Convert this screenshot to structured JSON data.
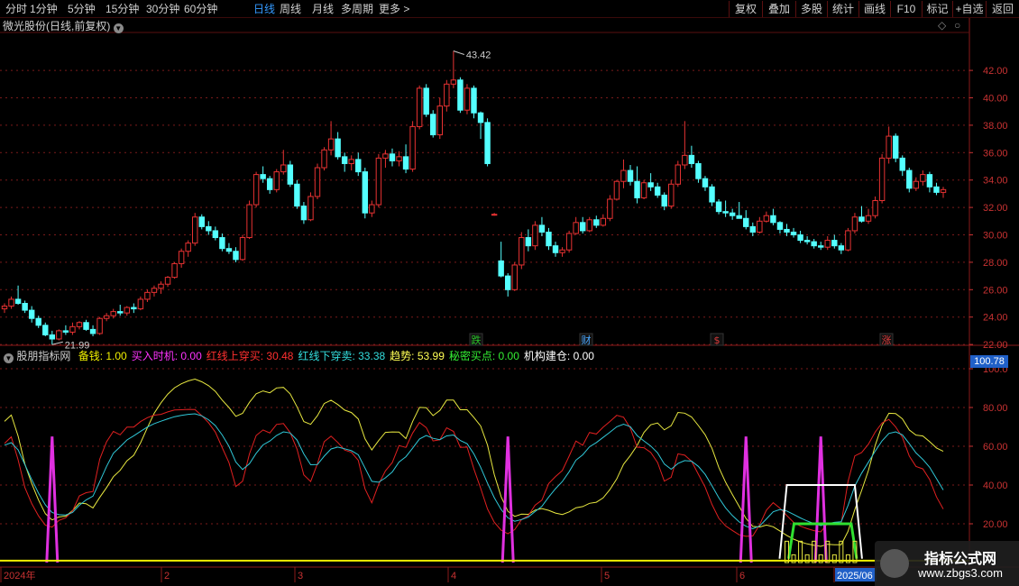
{
  "toolbar": {
    "periods": [
      "分时",
      "1分钟",
      "5分钟",
      "15分钟",
      "30分钟",
      "60分钟",
      "日线",
      "周线",
      "月线",
      "多周期",
      "更多 >"
    ],
    "active_period": "日线",
    "buttons": [
      "复权",
      "叠加",
      "多股",
      "统计",
      "画线",
      "F10",
      "标记",
      "+自选",
      "返回"
    ]
  },
  "main_panel": {
    "title": "微光股份(日线,前复权)",
    "max_label": "43.42",
    "min_label": "21.99",
    "price_axis": [
      "42.00",
      "40.00",
      "38.00",
      "36.00",
      "34.00",
      "32.00",
      "30.00",
      "28.00",
      "26.00",
      "24.00",
      "22.00"
    ],
    "event_marks": [
      {
        "label": "跌",
        "color": "#29c229"
      },
      {
        "label": "财",
        "color": "#4aa8ff"
      },
      {
        "label": "$",
        "color": "#d83a3a"
      },
      {
        "label": "涨",
        "color": "#d83a3a"
      }
    ]
  },
  "indicator_panel": {
    "name": "股朋指标网",
    "items": [
      {
        "label": "备钱:",
        "value": "1.00",
        "color": "#f0f000"
      },
      {
        "label": "买入时机:",
        "value": "0.00",
        "color": "#ff33ff"
      },
      {
        "label": "红线上穿买:",
        "value": "30.48",
        "color": "#ff3030"
      },
      {
        "label": "红线下穿卖:",
        "value": "33.38",
        "color": "#33dddd"
      },
      {
        "label": "趋势:",
        "value": "53.99",
        "color": "#ffff55"
      },
      {
        "label": "秘密买点:",
        "value": "0.00",
        "color": "#33ee33"
      },
      {
        "label": "机构建仓:",
        "value": "0.00",
        "color": "#ffffff"
      }
    ],
    "current_value": "100.78",
    "axis": [
      "100.0",
      "80.00",
      "60.00",
      "40.00",
      "20.00"
    ]
  },
  "date_axis": [
    "2024年",
    "2",
    "3",
    "4",
    "5",
    "6",
    "2025/06"
  ],
  "watermark": {
    "line1": "指标公式网",
    "line2": "www.zbgs3.com"
  },
  "colors": {
    "up": "#e83232",
    "down": "#54ffff",
    "grid": "#7a1a1a",
    "axis_text": "#c83232",
    "red_line": "#e02020",
    "cyan_line": "#30c8d8",
    "yellow_line": "#e8e840",
    "spike": "#e030e0",
    "green_box": "#30e030",
    "white_box": "#ffffff"
  },
  "chart_data": {
    "type": "candlestick",
    "series_note": "daily OHLC, start 2024-01",
    "ylim": [
      21.0,
      43.5
    ],
    "candles": [
      [
        24.6,
        25.0,
        24.3,
        24.8
      ],
      [
        24.8,
        25.5,
        24.6,
        25.3
      ],
      [
        25.3,
        26.3,
        24.9,
        25.0
      ],
      [
        25.0,
        25.2,
        24.3,
        24.5
      ],
      [
        24.5,
        24.8,
        23.6,
        23.9
      ],
      [
        23.9,
        24.1,
        23.2,
        23.4
      ],
      [
        23.4,
        23.6,
        22.6,
        22.7
      ],
      [
        22.7,
        23.0,
        21.99,
        22.4
      ],
      [
        22.4,
        23.1,
        22.3,
        23.0
      ],
      [
        23.0,
        23.4,
        22.7,
        22.9
      ],
      [
        22.9,
        23.6,
        22.7,
        23.3
      ],
      [
        23.3,
        23.7,
        23.1,
        23.6
      ],
      [
        23.6,
        23.8,
        23.0,
        23.1
      ],
      [
        23.1,
        23.4,
        22.6,
        22.8
      ],
      [
        22.8,
        24.0,
        22.7,
        23.9
      ],
      [
        23.9,
        24.3,
        23.7,
        24.1
      ],
      [
        24.1,
        24.6,
        23.9,
        24.4
      ],
      [
        24.4,
        24.9,
        24.1,
        24.3
      ],
      [
        24.3,
        24.8,
        24.1,
        24.7
      ],
      [
        24.7,
        25.0,
        24.3,
        24.6
      ],
      [
        24.6,
        25.5,
        24.5,
        25.3
      ],
      [
        25.3,
        26.0,
        25.1,
        25.8
      ],
      [
        25.8,
        26.3,
        25.5,
        26.1
      ],
      [
        26.1,
        26.6,
        25.7,
        26.4
      ],
      [
        26.4,
        27.0,
        26.2,
        26.9
      ],
      [
        26.9,
        28.0,
        26.8,
        27.9
      ],
      [
        27.9,
        29.0,
        27.6,
        28.8
      ],
      [
        28.8,
        29.6,
        28.4,
        29.4
      ],
      [
        29.4,
        31.6,
        29.2,
        31.3
      ],
      [
        31.3,
        31.5,
        30.4,
        30.6
      ],
      [
        30.6,
        31.0,
        30.0,
        30.3
      ],
      [
        30.3,
        30.6,
        29.6,
        29.8
      ],
      [
        29.8,
        30.1,
        28.8,
        29.0
      ],
      [
        29.0,
        29.4,
        28.6,
        28.8
      ],
      [
        28.8,
        29.1,
        28.0,
        28.2
      ],
      [
        28.2,
        30.0,
        28.1,
        29.8
      ],
      [
        29.8,
        32.5,
        29.7,
        32.2
      ],
      [
        32.2,
        34.6,
        32.0,
        34.4
      ],
      [
        34.4,
        35.0,
        33.8,
        34.1
      ],
      [
        34.1,
        34.3,
        33.0,
        33.3
      ],
      [
        33.3,
        34.8,
        33.1,
        34.6
      ],
      [
        34.6,
        36.2,
        34.4,
        35.1
      ],
      [
        35.1,
        35.4,
        33.5,
        33.7
      ],
      [
        33.7,
        34.0,
        31.9,
        32.1
      ],
      [
        32.1,
        32.4,
        30.8,
        31.1
      ],
      [
        31.1,
        33.1,
        31.0,
        32.8
      ],
      [
        32.8,
        35.2,
        32.6,
        34.9
      ],
      [
        34.9,
        36.4,
        34.7,
        36.2
      ],
      [
        36.2,
        38.3,
        35.8,
        37.0
      ],
      [
        37.0,
        37.5,
        35.5,
        35.7
      ],
      [
        35.7,
        36.0,
        34.6,
        35.2
      ],
      [
        35.2,
        35.8,
        34.7,
        35.5
      ],
      [
        35.5,
        36.0,
        34.3,
        34.6
      ],
      [
        34.6,
        34.9,
        31.2,
        31.6
      ],
      [
        31.6,
        32.5,
        31.3,
        32.2
      ],
      [
        32.2,
        35.9,
        32.0,
        35.6
      ],
      [
        35.6,
        36.2,
        34.9,
        35.9
      ],
      [
        35.9,
        36.3,
        35.0,
        35.4
      ],
      [
        35.4,
        36.1,
        35.0,
        35.7
      ],
      [
        35.7,
        36.6,
        34.5,
        34.8
      ],
      [
        34.8,
        38.3,
        34.6,
        37.9
      ],
      [
        37.9,
        40.9,
        37.7,
        40.7
      ],
      [
        40.7,
        41.0,
        38.6,
        38.8
      ],
      [
        38.8,
        39.1,
        37.1,
        37.3
      ],
      [
        37.3,
        40.0,
        37.0,
        39.4
      ],
      [
        39.4,
        41.3,
        39.0,
        41.0
      ],
      [
        41.0,
        43.42,
        40.7,
        41.3
      ],
      [
        41.3,
        41.5,
        38.9,
        39.1
      ],
      [
        39.1,
        41.0,
        38.8,
        40.7
      ],
      [
        40.7,
        40.9,
        38.5,
        38.9
      ],
      [
        38.9,
        39.0,
        37.0,
        38.2
      ],
      [
        38.2,
        38.5,
        35.0,
        35.2
      ],
      [
        31.5,
        31.6,
        31.4,
        31.5
      ],
      [
        28.1,
        29.5,
        26.9,
        27.0
      ],
      [
        27.0,
        27.2,
        25.5,
        26.0
      ],
      [
        26.0,
        28.0,
        25.9,
        27.8
      ],
      [
        27.8,
        30.2,
        27.5,
        29.8
      ],
      [
        29.8,
        30.4,
        28.8,
        29.2
      ],
      [
        29.2,
        31.0,
        28.9,
        30.7
      ],
      [
        30.7,
        31.3,
        29.9,
        30.2
      ],
      [
        30.2,
        30.5,
        28.9,
        29.2
      ],
      [
        29.2,
        29.5,
        28.4,
        28.7
      ],
      [
        28.7,
        29.1,
        28.4,
        28.9
      ],
      [
        28.9,
        30.3,
        28.7,
        30.1
      ],
      [
        30.1,
        31.3,
        30.0,
        30.9
      ],
      [
        30.9,
        31.3,
        30.1,
        30.3
      ],
      [
        30.3,
        31.3,
        30.2,
        31.1
      ],
      [
        31.1,
        31.4,
        30.5,
        30.7
      ],
      [
        30.7,
        31.5,
        30.6,
        31.2
      ],
      [
        31.2,
        32.9,
        31.0,
        32.6
      ],
      [
        32.6,
        34.0,
        32.5,
        33.9
      ],
      [
        33.9,
        35.5,
        33.4,
        34.7
      ],
      [
        34.7,
        35.1,
        33.6,
        33.9
      ],
      [
        33.9,
        35.0,
        32.3,
        32.7
      ],
      [
        32.7,
        34.0,
        32.6,
        33.8
      ],
      [
        33.8,
        34.5,
        33.2,
        33.5
      ],
      [
        33.5,
        33.8,
        32.7,
        32.9
      ],
      [
        32.9,
        33.1,
        31.8,
        32.1
      ],
      [
        32.1,
        34.0,
        31.9,
        33.7
      ],
      [
        33.7,
        35.4,
        33.5,
        35.1
      ],
      [
        35.1,
        38.3,
        34.8,
        35.8
      ],
      [
        35.8,
        36.5,
        34.9,
        35.2
      ],
      [
        35.2,
        35.4,
        33.8,
        34.1
      ],
      [
        34.1,
        34.3,
        33.2,
        33.5
      ],
      [
        33.5,
        33.7,
        32.1,
        32.4
      ],
      [
        32.4,
        32.6,
        31.5,
        31.7
      ],
      [
        31.7,
        32.5,
        31.3,
        31.6
      ],
      [
        31.6,
        31.9,
        31.1,
        31.4
      ],
      [
        31.4,
        32.4,
        31.2,
        31.2
      ],
      [
        31.2,
        31.8,
        30.4,
        30.6
      ],
      [
        30.6,
        30.9,
        29.9,
        30.2
      ],
      [
        30.2,
        31.3,
        30.1,
        31.0
      ],
      [
        31.0,
        31.7,
        30.9,
        31.4
      ],
      [
        31.4,
        31.9,
        30.7,
        30.9
      ],
      [
        30.9,
        31.0,
        30.1,
        30.4
      ],
      [
        30.4,
        30.8,
        29.9,
        30.2
      ],
      [
        30.2,
        30.5,
        29.8,
        30.0
      ],
      [
        30.0,
        30.3,
        29.4,
        29.6
      ],
      [
        29.6,
        29.9,
        29.3,
        29.5
      ],
      [
        29.5,
        29.7,
        29.0,
        29.2
      ],
      [
        29.2,
        29.5,
        28.9,
        29.1
      ],
      [
        29.1,
        29.9,
        28.9,
        29.6
      ],
      [
        29.6,
        30.0,
        29.0,
        29.2
      ],
      [
        29.2,
        29.4,
        28.6,
        28.9
      ],
      [
        28.9,
        30.5,
        28.8,
        30.3
      ],
      [
        30.3,
        31.6,
        30.1,
        31.3
      ],
      [
        31.3,
        32.1,
        30.9,
        31.0
      ],
      [
        31.0,
        31.9,
        30.8,
        31.4
      ],
      [
        31.4,
        32.8,
        31.2,
        32.5
      ],
      [
        32.5,
        35.9,
        32.3,
        35.6
      ],
      [
        35.6,
        37.9,
        35.2,
        37.2
      ],
      [
        37.2,
        37.4,
        35.3,
        35.6
      ],
      [
        35.6,
        35.8,
        34.3,
        34.7
      ],
      [
        34.7,
        34.9,
        33.1,
        33.4
      ],
      [
        33.4,
        34.2,
        33.2,
        33.9
      ],
      [
        33.9,
        34.7,
        33.6,
        34.4
      ],
      [
        34.4,
        34.6,
        33.1,
        33.5
      ],
      [
        33.5,
        33.8,
        32.9,
        33.1
      ],
      [
        33.1,
        33.5,
        32.7,
        33.3
      ]
    ]
  }
}
